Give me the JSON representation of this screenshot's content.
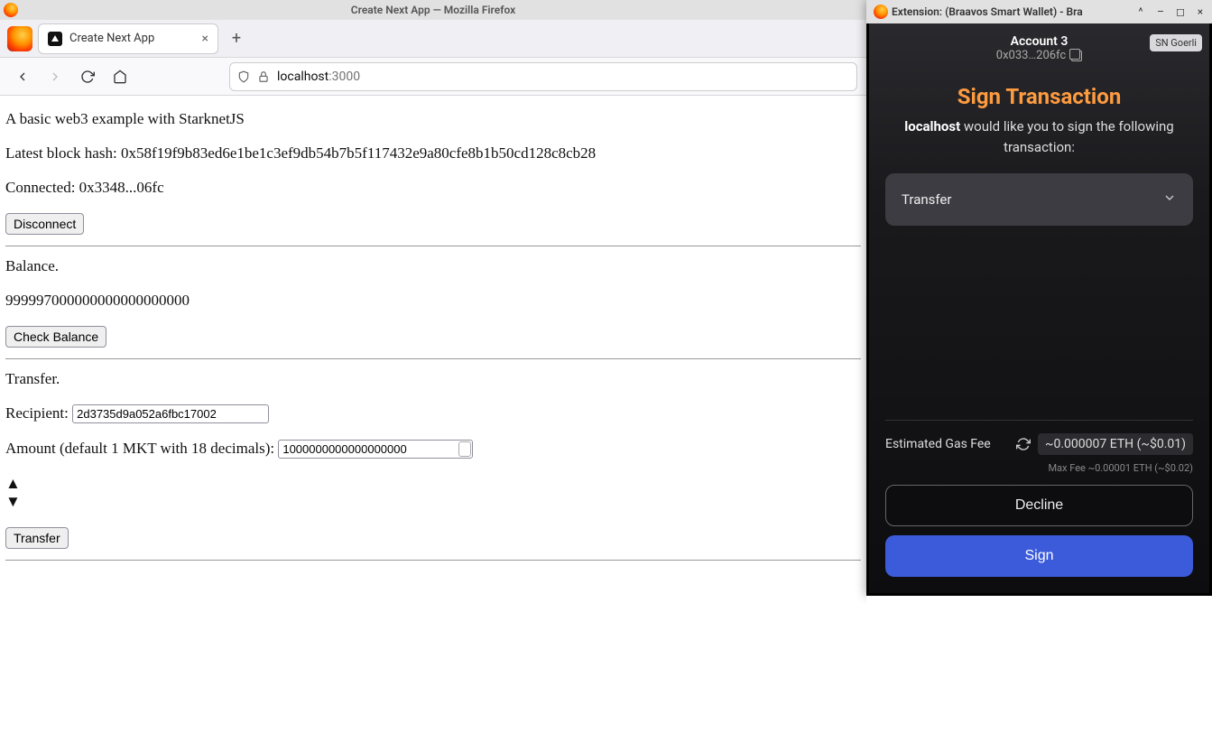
{
  "main_window": {
    "title": "Create Next App — Mozilla Firefox",
    "tab": {
      "label": "Create Next App"
    },
    "url": {
      "host": "localhost",
      "port": ":3000"
    }
  },
  "page": {
    "intro": "A basic web3 example with StarknetJS",
    "block_hash_label": "Latest block hash: ",
    "block_hash": "0x58f19f9b83ed6e1be1c3ef9db54b7b5f117432e9a80cfe8b1b50cd128c8cb28",
    "connected_label": "Connected: ",
    "connected_value": "0x3348...06fc",
    "disconnect_btn": "Disconnect",
    "balance_heading": "Balance.",
    "balance_value": "999997000000000000000000",
    "check_balance_btn": "Check Balance",
    "transfer_heading": "Transfer.",
    "recipient_label": "Recipient:",
    "recipient_value": "2d3735d9a052a6fbc17002",
    "amount_label": "Amount (default 1 MKT with 18 decimals):",
    "amount_value": "1000000000000000000",
    "transfer_btn": "Transfer"
  },
  "ext": {
    "window_title": "Extension: (Braavos Smart Wallet) - Bra",
    "account_name": "Account 3",
    "account_addr": "0x033…206fc",
    "network": "SN Goerli",
    "sign_title": "Sign Transaction",
    "sign_sub_host": "localhost",
    "sign_sub_rest": " would like you to sign the following transaction:",
    "tx_type": "Transfer",
    "fee_label": "Estimated Gas Fee",
    "fee_value": "~0.000007 ETH (~$0.01)",
    "fee_max": "Max Fee ~0.00001 ETH (~$0.02)",
    "decline_btn": "Decline",
    "sign_btn": "Sign"
  }
}
